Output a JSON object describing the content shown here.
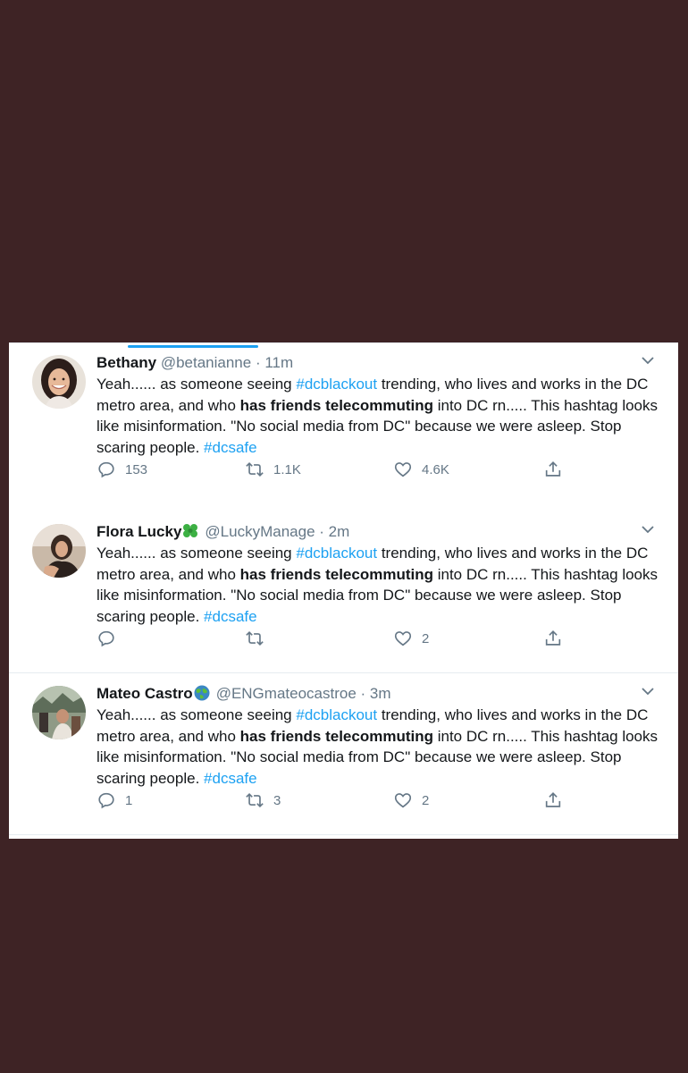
{
  "tweets": [
    {
      "name": "Flora Lucky",
      "emoji": "four-leaf-clover-icon",
      "handle": "@LuckyManage",
      "separator": " · ",
      "time": "2m",
      "text": {
        "t1": "Yeah...... as someone seeing ",
        "tag1": "#dcblackout",
        "t2": " trending, who lives and works in the DC metro area, and who ",
        "bold": "has friends telecommuting",
        "t3": " into DC rn..... This hashtag looks like misinformation. \"No social media from DC\" because we were asleep. Stop scaring people. ",
        "tag2": "#dcsafe"
      },
      "replies": "",
      "retweets": "",
      "likes": "2"
    },
    {
      "name": "Mateo Castro",
      "emoji": "globe-icon",
      "handle": "@ENGmateocastroe",
      "separator": " · ",
      "time": "3m",
      "text": {
        "t1": "Yeah...... as someone seeing ",
        "tag1": "#dcblackout",
        "t2": " trending, who lives and works in the DC metro area, and who ",
        "bold": "has friends telecommuting",
        "t3": " into DC rn..... This hashtag looks like misinformation. \"No social media from DC\" because we were asleep. Stop scaring people. ",
        "tag2": "#dcsafe"
      },
      "replies": "1",
      "retweets": "3",
      "likes": "2"
    },
    {
      "name": "Bethany",
      "emoji": "",
      "handle": "@betanianne",
      "separator": " · ",
      "time": "11m",
      "text": {
        "t1": "Yeah...... as someone seeing ",
        "tag1": "#dcblackout",
        "t2": " trending, who lives and works in the DC metro area, and who ",
        "bold": "has friends telecommuting",
        "t3": " into DC rn..... This hashtag looks like misinformation. \"No social media from DC\" because we were asleep. Stop scaring people. ",
        "tag2": "#dcsafe"
      },
      "replies": "153",
      "retweets": "1.1K",
      "likes": "4.6K"
    }
  ],
  "colors": {
    "background": "#3e2325",
    "accent": "#1da1f2",
    "muted": "#657786",
    "text": "#14171a"
  }
}
